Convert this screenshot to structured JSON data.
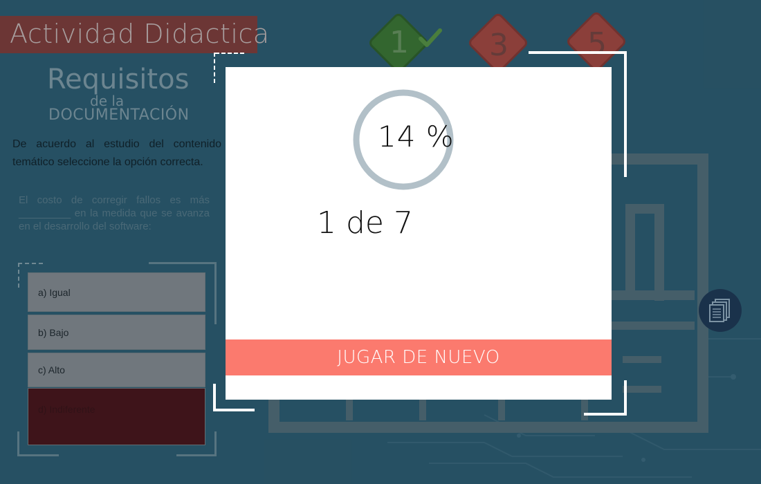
{
  "activity": {
    "title": "Actividad Didactica",
    "heading_line1": "Requisitos",
    "heading_line2": "de la",
    "heading_line3": "DOCUMENTACIÓN",
    "instructions": "De acuerdo al  estudio del contenido temático seleccione la opción correcta.",
    "question": "El costo de corregir fallos es más _________ en la medida que se avanza en el desarrollo del software:",
    "options": [
      {
        "label": "a) Igual"
      },
      {
        "label": "b) Bajo"
      },
      {
        "label": "c) Alto"
      },
      {
        "label": "d) Indiferente"
      }
    ],
    "selected_option": "d) Indiferente"
  },
  "levels": [
    {
      "number": "1",
      "completed": true,
      "color": "#3e7a2b"
    },
    {
      "number": "3",
      "completed": false,
      "color": "#b3463a"
    },
    {
      "number": "5",
      "completed": false,
      "color": "#b3463a"
    }
  ],
  "results_modal": {
    "percent_text": "14 %",
    "percent_value": 14,
    "score_text": "1 de 7",
    "play_again_label": "JUGAR DE NUEVO"
  },
  "icons": {
    "documents": "documents-icon",
    "check": "check-icon"
  },
  "colors": {
    "title_bar": "#8a3a33",
    "play_again": "#fb7a6e",
    "ring": "#b2c0c8",
    "selected_option": "#4c0d0f"
  }
}
